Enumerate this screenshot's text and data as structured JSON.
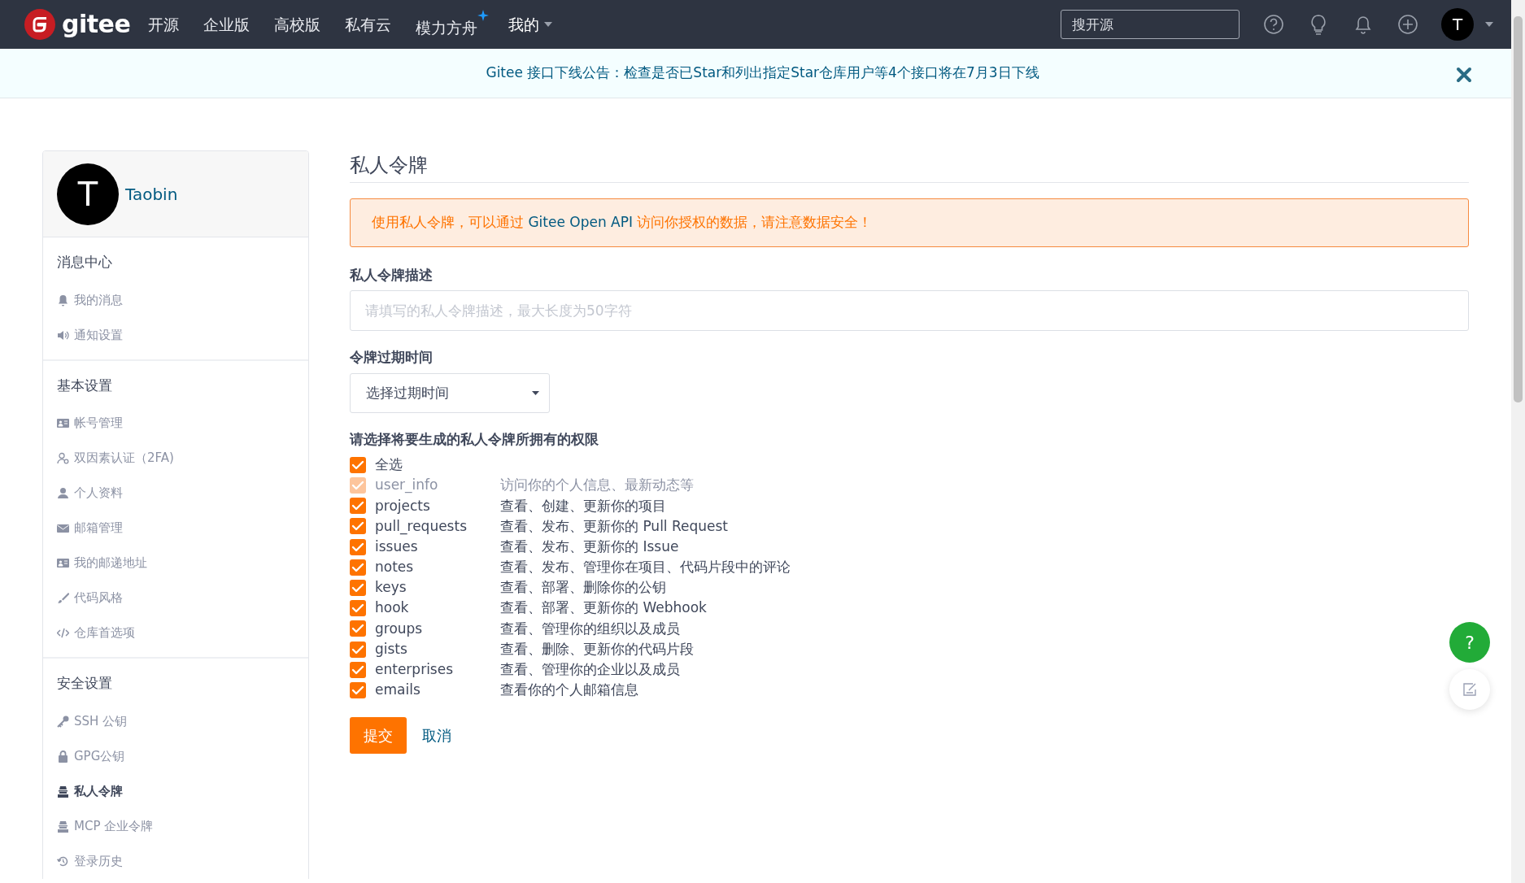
{
  "navbar": {
    "logo": "gitee",
    "links": [
      {
        "label": "开源",
        "sparkle": false,
        "dropdown": false
      },
      {
        "label": "企业版",
        "sparkle": false,
        "dropdown": false
      },
      {
        "label": "高校版",
        "sparkle": false,
        "dropdown": false
      },
      {
        "label": "私有云",
        "sparkle": false,
        "dropdown": false
      },
      {
        "label": "模力方舟",
        "sparkle": true,
        "dropdown": false
      },
      {
        "label": "我的",
        "sparkle": false,
        "dropdown": true
      }
    ],
    "search": {
      "placeholder": "搜开源"
    },
    "avatar": "T"
  },
  "notice": {
    "text": "Gitee 接口下线公告：检查是否已Star和列出指定Star仓库用户等4个接口将在7月3日下线"
  },
  "profile": {
    "avatar": "T",
    "name": "Taobin"
  },
  "sidebar": {
    "sections": [
      {
        "title": "消息中心",
        "items": [
          {
            "label": "我的消息",
            "selected": false
          },
          {
            "label": "通知设置",
            "selected": false
          }
        ]
      },
      {
        "title": "基本设置",
        "items": [
          {
            "label": "帐号管理",
            "selected": false
          },
          {
            "label": "双因素认证（2FA)",
            "selected": false
          },
          {
            "label": "个人资料",
            "selected": false
          },
          {
            "label": "邮箱管理",
            "selected": false
          },
          {
            "label": "我的邮递地址",
            "selected": false
          },
          {
            "label": "代码风格",
            "selected": false
          },
          {
            "label": "仓库首选项",
            "selected": false
          }
        ]
      },
      {
        "title": "安全设置",
        "items": [
          {
            "label": "SSH 公钥",
            "selected": false
          },
          {
            "label": "GPG公钥",
            "selected": false
          },
          {
            "label": "私人令牌",
            "selected": true
          },
          {
            "label": "MCP 企业令牌",
            "selected": false
          },
          {
            "label": "登录历史",
            "selected": false
          }
        ]
      }
    ]
  },
  "main": {
    "title": "私人令牌",
    "alert": {
      "before": "使用私人令牌，可以通过 ",
      "link": "Gitee Open API",
      "after": " 访问你授权的数据，请注意数据安全！"
    },
    "description": {
      "label": "私人令牌描述",
      "placeholder": "请填写的私人令牌描述，最大长度为50字符"
    },
    "expiry": {
      "label": "令牌过期时间",
      "value": "选择过期时间"
    },
    "permissions": {
      "heading": "请选择将要生成的私人令牌所拥有的权限",
      "select_all": {
        "label": "全选",
        "checked": true
      },
      "scopes": [
        {
          "name": "user_info",
          "description": "访问你的个人信息、最新动态等",
          "checked": true,
          "disabled": true
        },
        {
          "name": "projects",
          "description": "查看、创建、更新你的项目",
          "checked": true,
          "disabled": false
        },
        {
          "name": "pull_requests",
          "description": "查看、发布、更新你的 Pull Request",
          "checked": true,
          "disabled": false
        },
        {
          "name": "issues",
          "description": "查看、发布、更新你的 Issue",
          "checked": true,
          "disabled": false
        },
        {
          "name": "notes",
          "description": "查看、发布、管理你在项目、代码片段中的评论",
          "checked": true,
          "disabled": false
        },
        {
          "name": "keys",
          "description": "查看、部署、删除你的公钥",
          "checked": true,
          "disabled": false
        },
        {
          "name": "hook",
          "description": "查看、部署、更新你的 Webhook",
          "checked": true,
          "disabled": false
        },
        {
          "name": "groups",
          "description": "查看、管理你的组织以及成员",
          "checked": true,
          "disabled": false
        },
        {
          "name": "gists",
          "description": "查看、删除、更新你的代码片段",
          "checked": true,
          "disabled": false
        },
        {
          "name": "enterprises",
          "description": "查看、管理你的企业以及成员",
          "checked": true,
          "disabled": false
        },
        {
          "name": "emails",
          "description": "查看你的个人邮箱信息",
          "checked": true,
          "disabled": false
        }
      ]
    },
    "submit": "提交",
    "cancel": "取消"
  },
  "float": {
    "help": "?"
  }
}
